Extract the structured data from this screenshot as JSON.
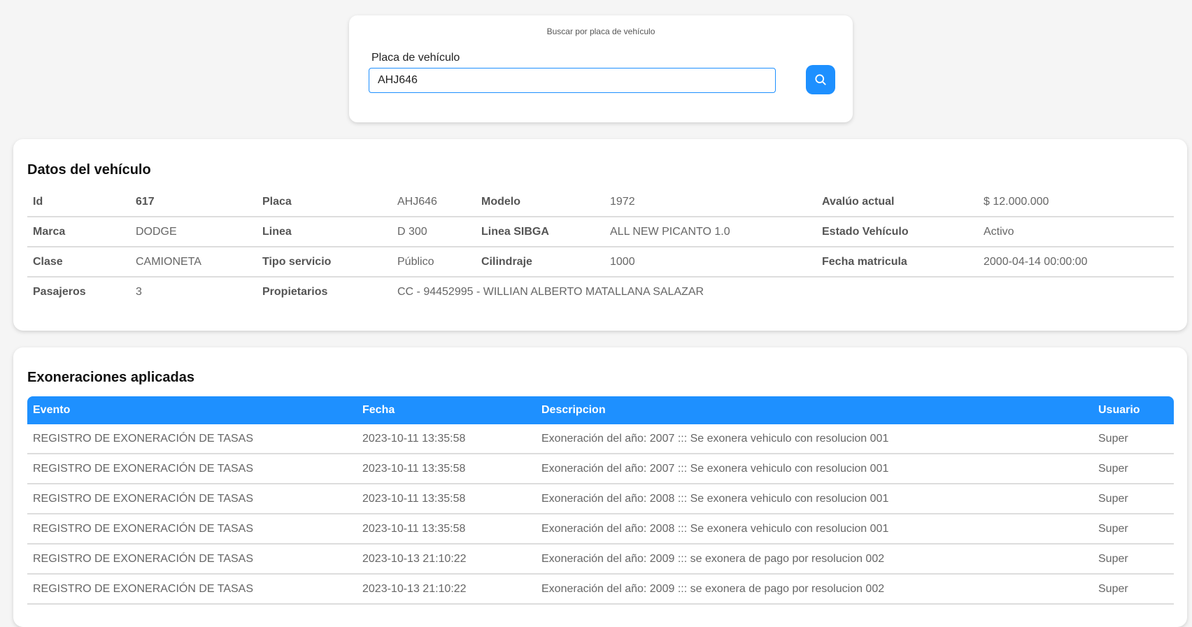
{
  "search": {
    "title": "Buscar por placa de vehículo",
    "label": "Placa de vehículo",
    "value": "AHJ646",
    "button_icon": "search-icon"
  },
  "vehicle": {
    "title": "Datos del vehículo",
    "rows": [
      [
        {
          "label": "Id",
          "value": "617"
        },
        {
          "label": "Placa",
          "value": "AHJ646"
        },
        {
          "label": "Modelo",
          "value": "1972"
        },
        {
          "label": "Avalúo actual",
          "value": "$ 12.000.000"
        }
      ],
      [
        {
          "label": "Marca",
          "value": "DODGE"
        },
        {
          "label": "Linea",
          "value": "D 300"
        },
        {
          "label": "Linea SIBGA",
          "value": "ALL NEW PICANTO 1.0"
        },
        {
          "label": "Estado Vehículo",
          "value": "Activo"
        }
      ],
      [
        {
          "label": "Clase",
          "value": "CAMIONETA"
        },
        {
          "label": "Tipo servicio",
          "value": "Público"
        },
        {
          "label": "Cilindraje",
          "value": "1000"
        },
        {
          "label": "Fecha matricula",
          "value": "2000-04-14 00:00:00"
        }
      ],
      [
        {
          "label": "Pasajeros",
          "value": "3"
        },
        {
          "label": "Propietarios",
          "value": "CC - 94452995 - WILLIAN ALBERTO MATALLANA SALAZAR"
        }
      ]
    ]
  },
  "exonerations": {
    "title": "Exoneraciones aplicadas",
    "columns": [
      "Evento",
      "Fecha",
      "Descripcion",
      "Usuario"
    ],
    "rows": [
      [
        "REGISTRO DE EXONERACIÓN DE TASAS",
        "2023-10-11 13:35:58",
        "Exoneración del año: 2007 ::: Se exonera vehiculo con resolucion 001",
        "Super"
      ],
      [
        "REGISTRO DE EXONERACIÓN DE TASAS",
        "2023-10-11 13:35:58",
        "Exoneración del año: 2007 ::: Se exonera vehiculo con resolucion 001",
        "Super"
      ],
      [
        "REGISTRO DE EXONERACIÓN DE TASAS",
        "2023-10-11 13:35:58",
        "Exoneración del año: 2008 ::: Se exonera vehiculo con resolucion 001",
        "Super"
      ],
      [
        "REGISTRO DE EXONERACIÓN DE TASAS",
        "2023-10-11 13:35:58",
        "Exoneración del año: 2008 ::: Se exonera vehiculo con resolucion 001",
        "Super"
      ],
      [
        "REGISTRO DE EXONERACIÓN DE TASAS",
        "2023-10-13 21:10:22",
        "Exoneración del año: 2009 ::: se exonera de pago por resolucion 002",
        "Super"
      ],
      [
        "REGISTRO DE EXONERACIÓN DE TASAS",
        "2023-10-13 21:10:22",
        "Exoneración del año: 2009 ::: se exonera de pago por resolucion 002",
        "Super"
      ]
    ]
  }
}
